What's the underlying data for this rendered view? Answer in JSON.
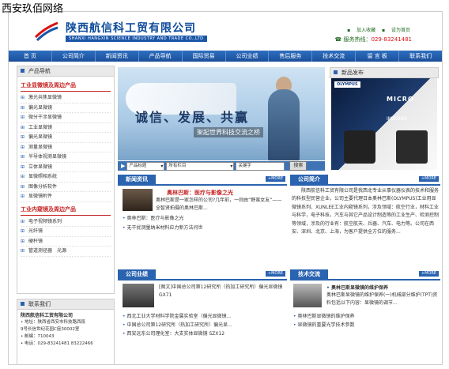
{
  "watermark": "西安玖佰网络",
  "company": {
    "name_cn": "陕西航信科工贸有限公司",
    "name_en": "SHANXI HANGXIN SCIENCE INDUSTRY AND TRADE CO.,LTD"
  },
  "toplinks": [
    "加入收藏",
    "设为首页"
  ],
  "hotline": {
    "label": "服务热线：",
    "number": "029-83241481"
  },
  "nav": [
    "首 页",
    "公司简介",
    "新闻资讯",
    "产品导航",
    "国际贸易",
    "公司业绩",
    "售后服务",
    "技术交流",
    "留 言 板",
    "联系我们"
  ],
  "product_nav": {
    "title": "产品导航",
    "groups": [
      {
        "title": "工业显微镜及周边产品",
        "items": [
          "激光共焦显微镜",
          "偏光显微镜",
          "微分干涉显微镜",
          "工业显微镜",
          "偏光显微镜",
          "测量显微镜",
          "半导体视测显微镜",
          "立体显微镜",
          "显微照相系统",
          "图像分析软件",
          "显微镜附件"
        ]
      },
      {
        "title": "工业内窥镜及周边产品",
        "items": [
          "电子视频镜系列",
          "光纤镜",
          "硬杆镜",
          "管道测径器　光源"
        ]
      }
    ]
  },
  "contact": {
    "title": "联系我们",
    "company": "陕西航信科工贸有限公司",
    "lines": [
      "地址：陕西省西安市科技路西段",
      "9号长信世纪花园C座30002室",
      "邮编：710043",
      "电话：029-83241481  83222466"
    ]
  },
  "banner": {
    "slogan": "诚信、发展、共赢",
    "sub": "架起世界科技交流之桥"
  },
  "search": {
    "opt1": "产品标题",
    "opt2": "所有栏目",
    "keyword_placeholder": "关键字",
    "button": "搜索"
  },
  "new_products": {
    "title": "新品发布",
    "img_brand": "OLYMPUS",
    "img_text1": "MICRO",
    "img_text2": "IMAGING"
  },
  "news": {
    "title": "新闻资讯",
    "more": "+MORE",
    "featured_title": "奥林巴斯：医疗与影像之光",
    "featured_text": "奥林巴斯是一家怎样的公司?几年前，一则由“野蛮女友”——全智贤拍摄的奥林巴斯...",
    "items": [
      "奥林巴斯：医疗与影像之光",
      "无干扰测量纳米材料应力新方法问世"
    ]
  },
  "intro": {
    "title": "公司简介",
    "more": "+MORE",
    "text": "陕西航信科工贸有限公司是我西北专业从事仪器仪表的技术和服务的科技型民营企业，公司主要代理日本奥林巴斯(OLYMPUS)工业用显微镜系列、XUNLEE工业内窥镜系列，涉及领域：航空行业，材料工业与科学，电子科技，汽车与其它产品设计制造等的工业生产、检测控制等领域，涉及的行业有：航空航天、兵器、汽车、电力等。公司在西安、深圳、北京、上海，为客户提供全方位的服务..."
  },
  "performance": {
    "title": "公司业绩",
    "more": "+MORE",
    "featured": "[图文]中国总公司第12研究所（热加工研究所）偏光显微镜GX71",
    "items": [
      "西北工业大学材料学院金属实验室（偏光显微镜...",
      "中国总公司第12研究所（热加工研究所）偏光显...",
      "西安远东公司理化室：大支实体显微镜 SZX12"
    ]
  },
  "tech": {
    "title": "技术交流",
    "more": "+MORE",
    "featured": "奥林巴斯显微镜的维护保养",
    "featured_text": "奥林巴斯显微镜的维护保养(一)机械部分维护(TPT)资料包括以下内容：显微镜的调节...",
    "items": [
      "奥林巴斯显微镜的维护保养",
      "显微镜的重要光学技术参数"
    ]
  }
}
